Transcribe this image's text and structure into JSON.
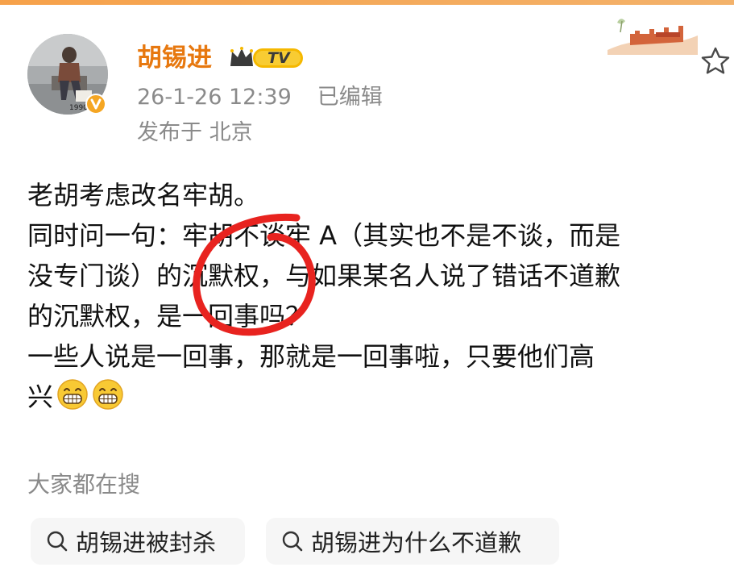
{
  "post": {
    "username": "胡锡进",
    "vip_badge": "TV",
    "timestamp": "26-1-26 12:39",
    "edited": "已编辑",
    "location": "发布于 北京",
    "body_lines": [
      "老胡考虑改名牢胡。",
      "同时问一句：牢胡不谈牢 A（其实也不是不谈，而是",
      "没专门谈）的沉默权，与如果某名人说了错话不道歉",
      "的沉默权，是一回事吗？",
      "一些人说是一回事，那就是一回事啦，只要他们高",
      "兴"
    ],
    "emojis": [
      "grin-emoji",
      "grin-emoji"
    ]
  },
  "hot_search": {
    "label": "大家都在搜",
    "items": [
      {
        "label": "胡锡进被封杀"
      },
      {
        "label": "胡锡进为什么不道歉"
      }
    ]
  },
  "colors": {
    "username": "#e7780f",
    "meta": "#8a8a8a",
    "annotation": "#e8231f",
    "chip_bg": "#f6f6f6",
    "top_bar": "#f6a14a"
  },
  "icons": {
    "favorite": "star-icon",
    "search": "search-icon",
    "verified": "verified-badge-icon",
    "vip": "crown-icon"
  }
}
